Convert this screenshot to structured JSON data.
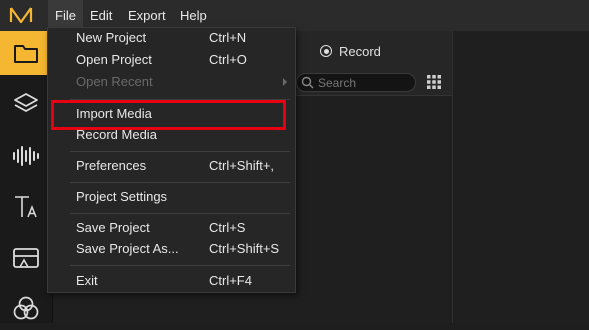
{
  "menubar": {
    "items": [
      "File",
      "Edit",
      "Export",
      "Help"
    ],
    "active": "File"
  },
  "toolbar": {
    "tools": [
      "folder-icon",
      "layers-icon",
      "audio-waveform-icon",
      "text-icon",
      "transition-icon",
      "effects-icon"
    ],
    "selected": "folder-icon",
    "accent": "#f5b731"
  },
  "media_panel": {
    "record_label": "Record",
    "search_placeholder": "Search"
  },
  "file_menu": {
    "items": [
      {
        "label": "New Project",
        "shortcut": "Ctrl+N"
      },
      {
        "label": "Open Project",
        "shortcut": "Ctrl+O"
      },
      {
        "label": "Open Recent",
        "shortcut": ""
      },
      {
        "label": "Import Media",
        "shortcut": ""
      },
      {
        "label": "Record Media",
        "shortcut": ""
      },
      {
        "label": "Preferences",
        "shortcut": "Ctrl+Shift+,"
      },
      {
        "label": "Project Settings",
        "shortcut": ""
      },
      {
        "label": "Save Project",
        "shortcut": "Ctrl+S"
      },
      {
        "label": "Save Project As...",
        "shortcut": "Ctrl+Shift+S"
      },
      {
        "label": "Exit",
        "shortcut": "Ctrl+F4"
      }
    ],
    "disabled_item": "Open Recent",
    "highlighted_item": "Import Media",
    "highlight_color": "#e60012"
  }
}
